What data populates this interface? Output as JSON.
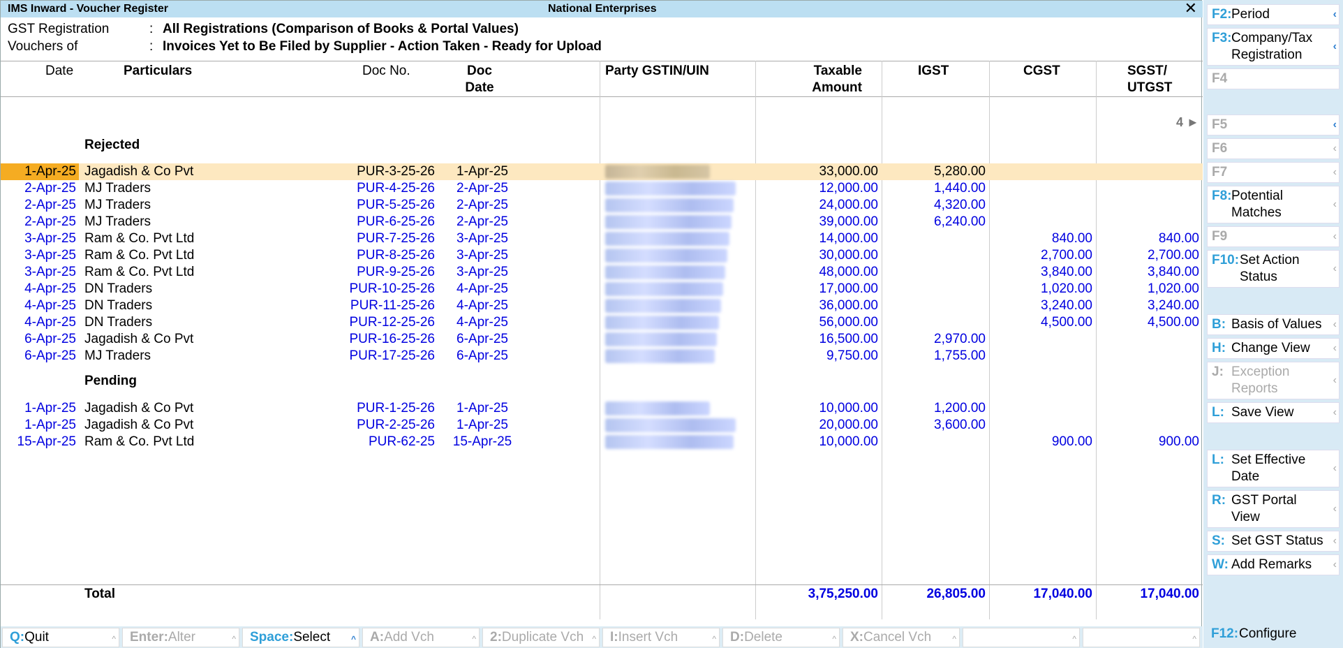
{
  "window": {
    "title": "IMS Inward - Voucher Register",
    "company": "National Enterprises",
    "close": "✕"
  },
  "info": {
    "gst_label": "GST Registration",
    "gst_value": "All Registrations (Comparison of Books & Portal Values)",
    "vouchers_label": "Vouchers of",
    "vouchers_value": "Invoices Yet to Be Filed by Supplier - Action Taken - Ready for Upload",
    "colon": ":"
  },
  "columns": {
    "date": "Date",
    "particulars": "Particulars",
    "doc_no": "Doc No.",
    "doc_date_1": "Doc",
    "doc_date_2": "Date",
    "gstin": "Party GSTIN/UIN",
    "taxable_1": "Taxable",
    "taxable_2": "Amount",
    "igst": "IGST",
    "cgst": "CGST",
    "sgst_1": "SGST/",
    "sgst_2": "UTGST"
  },
  "page_indicator": "4 ►",
  "groups": {
    "rejected": "Rejected",
    "pending": "Pending"
  },
  "rejected": [
    {
      "date": "1-Apr-25",
      "party": "Jagadish & Co Pvt",
      "doc": "PUR-3-25-26",
      "docdate": "1-Apr-25",
      "taxable": "33,000.00",
      "igst": "5,280.00",
      "cgst": "",
      "sgst": ""
    },
    {
      "date": "2-Apr-25",
      "party": "MJ Traders",
      "doc": "PUR-4-25-26",
      "docdate": "2-Apr-25",
      "taxable": "12,000.00",
      "igst": "1,440.00",
      "cgst": "",
      "sgst": ""
    },
    {
      "date": "2-Apr-25",
      "party": "MJ Traders",
      "doc": "PUR-5-25-26",
      "docdate": "2-Apr-25",
      "taxable": "24,000.00",
      "igst": "4,320.00",
      "cgst": "",
      "sgst": ""
    },
    {
      "date": "2-Apr-25",
      "party": "MJ Traders",
      "doc": "PUR-6-25-26",
      "docdate": "2-Apr-25",
      "taxable": "39,000.00",
      "igst": "6,240.00",
      "cgst": "",
      "sgst": ""
    },
    {
      "date": "3-Apr-25",
      "party": "Ram & Co. Pvt Ltd",
      "doc": "PUR-7-25-26",
      "docdate": "3-Apr-25",
      "taxable": "14,000.00",
      "igst": "",
      "cgst": "840.00",
      "sgst": "840.00"
    },
    {
      "date": "3-Apr-25",
      "party": "Ram & Co. Pvt Ltd",
      "doc": "PUR-8-25-26",
      "docdate": "3-Apr-25",
      "taxable": "30,000.00",
      "igst": "",
      "cgst": "2,700.00",
      "sgst": "2,700.00"
    },
    {
      "date": "3-Apr-25",
      "party": "Ram & Co. Pvt Ltd",
      "doc": "PUR-9-25-26",
      "docdate": "3-Apr-25",
      "taxable": "48,000.00",
      "igst": "",
      "cgst": "3,840.00",
      "sgst": "3,840.00"
    },
    {
      "date": "4-Apr-25",
      "party": "DN Traders",
      "doc": "PUR-10-25-26",
      "docdate": "4-Apr-25",
      "taxable": "17,000.00",
      "igst": "",
      "cgst": "1,020.00",
      "sgst": "1,020.00"
    },
    {
      "date": "4-Apr-25",
      "party": "DN Traders",
      "doc": "PUR-11-25-26",
      "docdate": "4-Apr-25",
      "taxable": "36,000.00",
      "igst": "",
      "cgst": "3,240.00",
      "sgst": "3,240.00"
    },
    {
      "date": "4-Apr-25",
      "party": "DN Traders",
      "doc": "PUR-12-25-26",
      "docdate": "4-Apr-25",
      "taxable": "56,000.00",
      "igst": "",
      "cgst": "4,500.00",
      "sgst": "4,500.00"
    },
    {
      "date": "6-Apr-25",
      "party": "Jagadish & Co Pvt",
      "doc": "PUR-16-25-26",
      "docdate": "6-Apr-25",
      "taxable": "16,500.00",
      "igst": "2,970.00",
      "cgst": "",
      "sgst": ""
    },
    {
      "date": "6-Apr-25",
      "party": "MJ Traders",
      "doc": "PUR-17-25-26",
      "docdate": "6-Apr-25",
      "taxable": "9,750.00",
      "igst": "1,755.00",
      "cgst": "",
      "sgst": ""
    }
  ],
  "pending": [
    {
      "date": "1-Apr-25",
      "party": "Jagadish & Co Pvt",
      "doc": "PUR-1-25-26",
      "docdate": "1-Apr-25",
      "taxable": "10,000.00",
      "igst": "1,200.00",
      "cgst": "",
      "sgst": ""
    },
    {
      "date": "1-Apr-25",
      "party": "Jagadish & Co Pvt",
      "doc": "PUR-2-25-26",
      "docdate": "1-Apr-25",
      "taxable": "20,000.00",
      "igst": "3,600.00",
      "cgst": "",
      "sgst": ""
    },
    {
      "date": "15-Apr-25",
      "party": "Ram & Co. Pvt Ltd",
      "doc": "PUR-62-25",
      "docdate": "15-Apr-25",
      "taxable": "10,000.00",
      "igst": "",
      "cgst": "900.00",
      "sgst": "900.00"
    }
  ],
  "total": {
    "label": "Total",
    "taxable": "3,75,250.00",
    "igst": "26,805.00",
    "cgst": "17,040.00",
    "sgst": "17,040.00"
  },
  "bottom": [
    {
      "key": "Q:",
      "label": "Quit"
    },
    {
      "key": "Enter:",
      "label": "Alter"
    },
    {
      "key": "Space:",
      "label": "Select"
    },
    {
      "key": "A:",
      "label": "Add Vch"
    },
    {
      "key": "2:",
      "label": "Duplicate Vch"
    },
    {
      "key": "I:",
      "label": "Insert Vch"
    },
    {
      "key": "D:",
      "label": "Delete"
    },
    {
      "key": "X:",
      "label": "Cancel Vch"
    },
    {
      "key": "",
      "label": ""
    },
    {
      "key": "",
      "label": ""
    }
  ],
  "sidebar": {
    "f2": {
      "key": "F2:",
      "label": "Period"
    },
    "f3": {
      "key": "F3:",
      "label1": "Company/Tax",
      "label2": "Registration"
    },
    "f4": {
      "key": "F4"
    },
    "f5": {
      "key": "F5"
    },
    "f6": {
      "key": "F6"
    },
    "f7": {
      "key": "F7"
    },
    "f8": {
      "key": "F8:",
      "label1": "Potential",
      "label2": "Matches"
    },
    "f9": {
      "key": "F9"
    },
    "f10": {
      "key": "F10:",
      "label1": "Set Action",
      "label2": "Status"
    },
    "b": {
      "key": "B:",
      "label": "Basis of Values"
    },
    "h": {
      "key": "H:",
      "label": "Change View"
    },
    "j": {
      "key": "J:",
      "label1": "Exception",
      "label2": "Reports"
    },
    "l": {
      "key": "L:",
      "label": "Save View"
    },
    "l2": {
      "key": "L:",
      "label1": "Set Effective",
      "label2": "Date"
    },
    "r": {
      "key": "R:",
      "label1": "GST Portal",
      "label2": "View"
    },
    "s": {
      "key": "S:",
      "label": "Set GST Status"
    },
    "w": {
      "key": "W:",
      "label": "Add Remarks"
    },
    "f12": {
      "key": "F12:",
      "label": "Configure"
    },
    "arrow": "‹"
  }
}
